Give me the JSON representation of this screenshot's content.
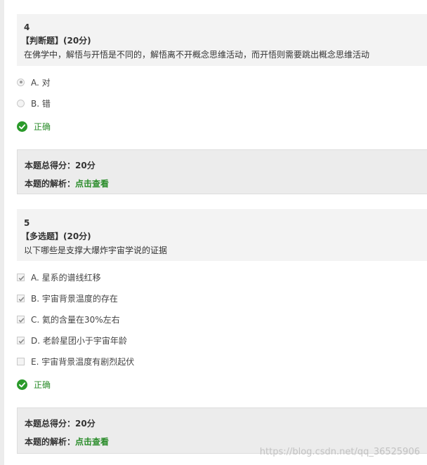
{
  "questions": [
    {
      "number": "4",
      "type_label": "【判断题】(20分)",
      "stem": "在佛学中，解悟与开悟是不同的，解悟离不开概念思维活动，而开悟则需要跳出概念思维活动",
      "options": [
        {
          "label": "A. 对",
          "selected": true
        },
        {
          "label": "B. 错",
          "selected": false
        }
      ],
      "result": "正确",
      "score_label": "本题总得分：",
      "score_value": "20分",
      "analysis_label": "本题的解析：",
      "analysis_link": "点击查看"
    },
    {
      "number": "5",
      "type_label": "【多选题】(20分)",
      "stem": "以下哪些是支撑大爆炸宇宙学说的证据",
      "options": [
        {
          "label": "A. 星系的谱线红移",
          "selected": true
        },
        {
          "label": "B. 宇宙背景温度的存在",
          "selected": true
        },
        {
          "label": "C. 氦的含量在30%左右",
          "selected": true
        },
        {
          "label": "D. 老龄星团小于宇宙年龄",
          "selected": true
        },
        {
          "label": "E. 宇宙背景温度有剧烈起伏",
          "selected": false
        }
      ],
      "result": "正确",
      "score_label": "本题总得分：",
      "score_value": "20分",
      "analysis_label": "本题的解析：",
      "analysis_link": "点击查看"
    }
  ],
  "watermark": "https://blog.csdn.net/qq_36525906",
  "colors": {
    "correct_green": "#2a8c2a",
    "header_bg": "#f3f3f3",
    "score_bg": "#ececec"
  }
}
